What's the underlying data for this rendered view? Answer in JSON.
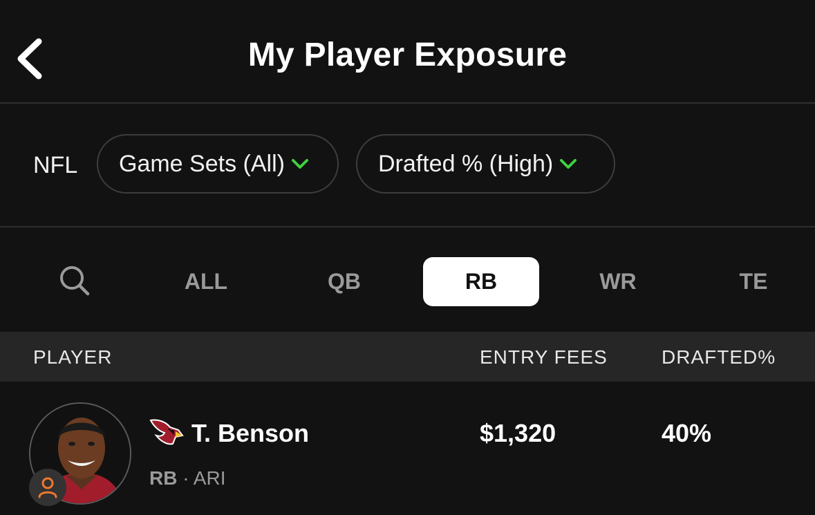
{
  "header": {
    "title": "My Player Exposure",
    "back_icon": "chevron-left-icon"
  },
  "filters": {
    "league": "NFL",
    "game_sets": {
      "label": "Game Sets (All)",
      "icon": "chevron-down-icon"
    },
    "sort": {
      "label": "Drafted % (High)",
      "icon": "chevron-down-icon"
    }
  },
  "position_tabs": {
    "search_icon": "search-icon",
    "items": [
      "ALL",
      "QB",
      "RB",
      "WR",
      "TE"
    ],
    "active": "RB"
  },
  "table": {
    "columns": {
      "player": "PLAYER",
      "entry_fees": "ENTRY FEES",
      "drafted": "DRAFTED%"
    },
    "rows": [
      {
        "name": "T. Benson",
        "position": "RB",
        "separator": "·",
        "team": "ARI",
        "entry_fees": "$1,320",
        "drafted": "40%",
        "team_logo": "cardinals-logo",
        "badge_icon": "user-icon"
      }
    ]
  },
  "colors": {
    "background": "#121212",
    "table_header": "#262626",
    "accent_green": "#3fd13f",
    "badge_orange": "#f0782d",
    "active_tab": "#ffffff",
    "muted_text": "#9a9a9a"
  }
}
